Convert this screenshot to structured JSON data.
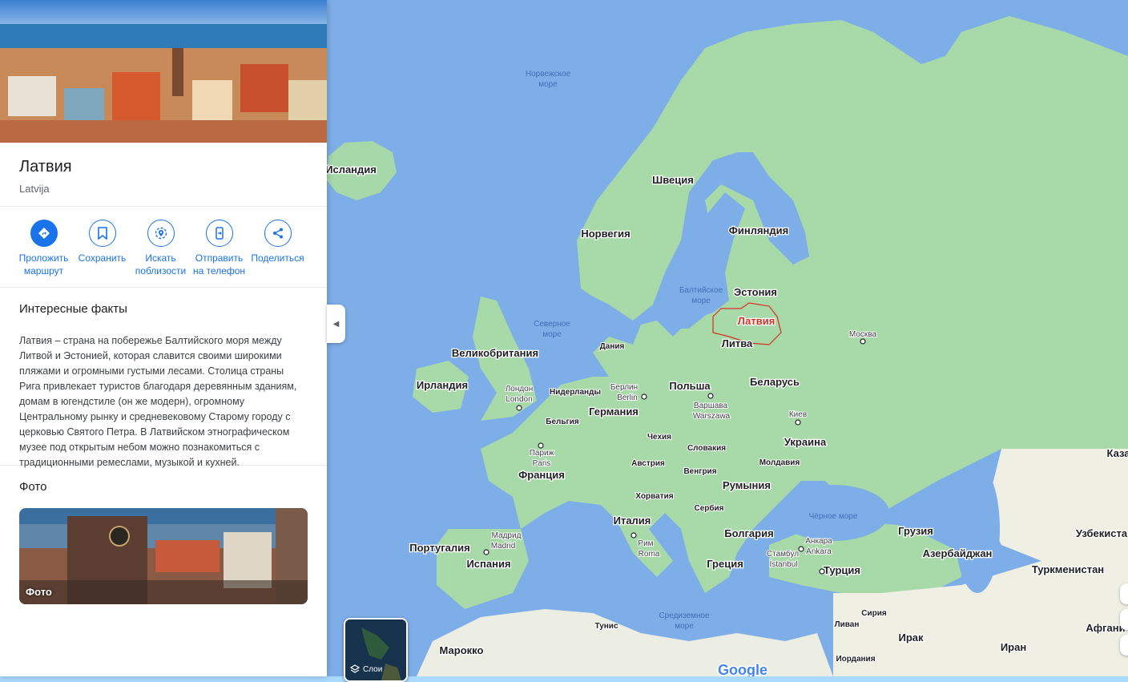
{
  "place": {
    "title": "Латвия",
    "subtitle": "Latvija"
  },
  "actions": [
    {
      "label": "Проложить маршрут",
      "icon": "directions-icon"
    },
    {
      "label": "Сохранить",
      "icon": "bookmark-icon"
    },
    {
      "label": "Искать поблизости",
      "icon": "nearby-icon"
    },
    {
      "label": "Отправить на телефон",
      "icon": "send-to-phone-icon"
    },
    {
      "label": "Поделиться",
      "icon": "share-icon"
    }
  ],
  "facts": {
    "title": "Интересные факты",
    "text": "Латвия – страна на побережье Балтийского моря между Литвой и Эстонией, которая славится своими широкими пляжами и огромными густыми лесами. Столица страны Рига привлекает туристов благодаря деревянным зданиям, домам в югендстиле (он же модерн), огромному Центральному рынку и средневековому Старому городу с церковью Святого Петра. В Латвийском этнографическом музее под открытым небом можно познакомиться с традиционными ремеслами, музыкой и кухней."
  },
  "photos": {
    "title": "Фото",
    "card_label": "Фото"
  },
  "layers": {
    "label": "Слои"
  },
  "map": {
    "logo": "Google",
    "seas": {
      "norwegian_1": "Норвежское",
      "norwegian_2": "море",
      "baltic_1": "Балтийское",
      "baltic_2": "море",
      "north_1": "Северное",
      "north_2": "море",
      "black": "Чёрное море",
      "med_1": "Средиземное",
      "med_2": "море"
    },
    "countries": {
      "iceland": "Исландия",
      "sweden": "Швеция",
      "norway": "Норвегия",
      "finland": "Финляндия",
      "estonia": "Эстония",
      "latvia": "Латвия",
      "lithuania": "Литва",
      "denmark": "Дания",
      "uk": "Великобритания",
      "ireland": "Ирландия",
      "netherlands": "Нидерланды",
      "germany": "Германия",
      "poland": "Польша",
      "belarus": "Беларусь",
      "belgium": "Бельгия",
      "czechia": "Чехия",
      "slovakia": "Словакия",
      "ukraine": "Украина",
      "austria": "Австрия",
      "hungary": "Венгрия",
      "moldova": "Молдавия",
      "romania": "Румыния",
      "france": "Франция",
      "croatia": "Хорватия",
      "serbia": "Сербия",
      "italy": "Италия",
      "bulgaria": "Болгария",
      "portugal": "Португалия",
      "spain": "Испания",
      "greece": "Греция",
      "turkey": "Турция",
      "georgia": "Грузия",
      "azerbaijan": "Азербайджан",
      "uzbekistan": "Узбекиста",
      "turkmenistan": "Туркменистан",
      "kazakh": "Каза",
      "syria": "Сирия",
      "lebanon": "Ливан",
      "iraq": "Ирак",
      "iran": "Иран",
      "jordan": "Иордания",
      "afghan": "Афгани",
      "tunisia": "Тунис",
      "morocco": "Марокко"
    },
    "cities": {
      "moscow": "Москва",
      "london_ru": "Лондон",
      "london_en": "London",
      "berlin_ru": "Берлин",
      "berlin_en": "Berlin",
      "warsaw_ru": "Варшава",
      "warsaw_en": "Warszawa",
      "kyiv": "Киев",
      "paris_ru": "Париж",
      "paris_en": "Paris",
      "madrid_ru": "Мадрид",
      "madrid_en": "Madrid",
      "rome_ru": "Рим",
      "rome_en": "Roma",
      "istanbul_ru": "Стамбул",
      "istanbul_en": "İstanbul",
      "ankara_ru": "Анкара",
      "ankara_en": "Ankara"
    }
  },
  "colors": {
    "accent": "#1a73e8",
    "water": "#7fb0e6",
    "land": "#a8d9a8",
    "latvia_border": "#d93025"
  }
}
